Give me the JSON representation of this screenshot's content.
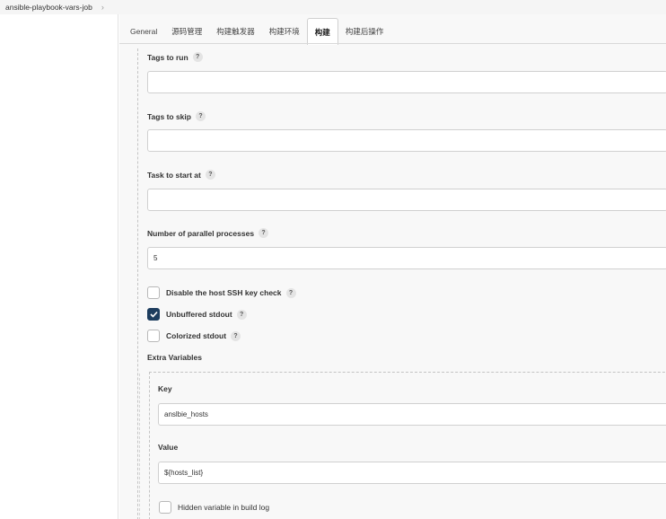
{
  "breadcrumb": {
    "job": "ansible-playbook-vars-job"
  },
  "tabs": [
    {
      "label": "General"
    },
    {
      "label": "源码管理"
    },
    {
      "label": "构建触发器"
    },
    {
      "label": "构建环境"
    },
    {
      "label": "构建"
    },
    {
      "label": "构建后操作"
    }
  ],
  "help_glyph": "?",
  "fields": {
    "tags_to_run": {
      "label": "Tags to run",
      "value": ""
    },
    "tags_to_skip": {
      "label": "Tags to skip",
      "value": ""
    },
    "task_to_start_at": {
      "label": "Task to start at",
      "value": ""
    },
    "parallel": {
      "label": "Number of parallel processes",
      "value": "5"
    }
  },
  "checkboxes": {
    "disable_ssh": {
      "label": "Disable the host SSH key check",
      "checked": false
    },
    "unbuffered": {
      "label": "Unbuffered stdout",
      "checked": true
    },
    "colorized": {
      "label": "Colorized stdout",
      "checked": false
    }
  },
  "extra_variables": {
    "title": "Extra Variables",
    "key_label": "Key",
    "key_value": "anslbie_hosts",
    "value_label": "Value",
    "value_value": "${hosts_list}",
    "hidden_label": "Hidden variable in build log",
    "hidden_checked": false
  },
  "colors": {
    "accent": "#1d3d5e",
    "panel_bg": "#f8f8f8"
  }
}
